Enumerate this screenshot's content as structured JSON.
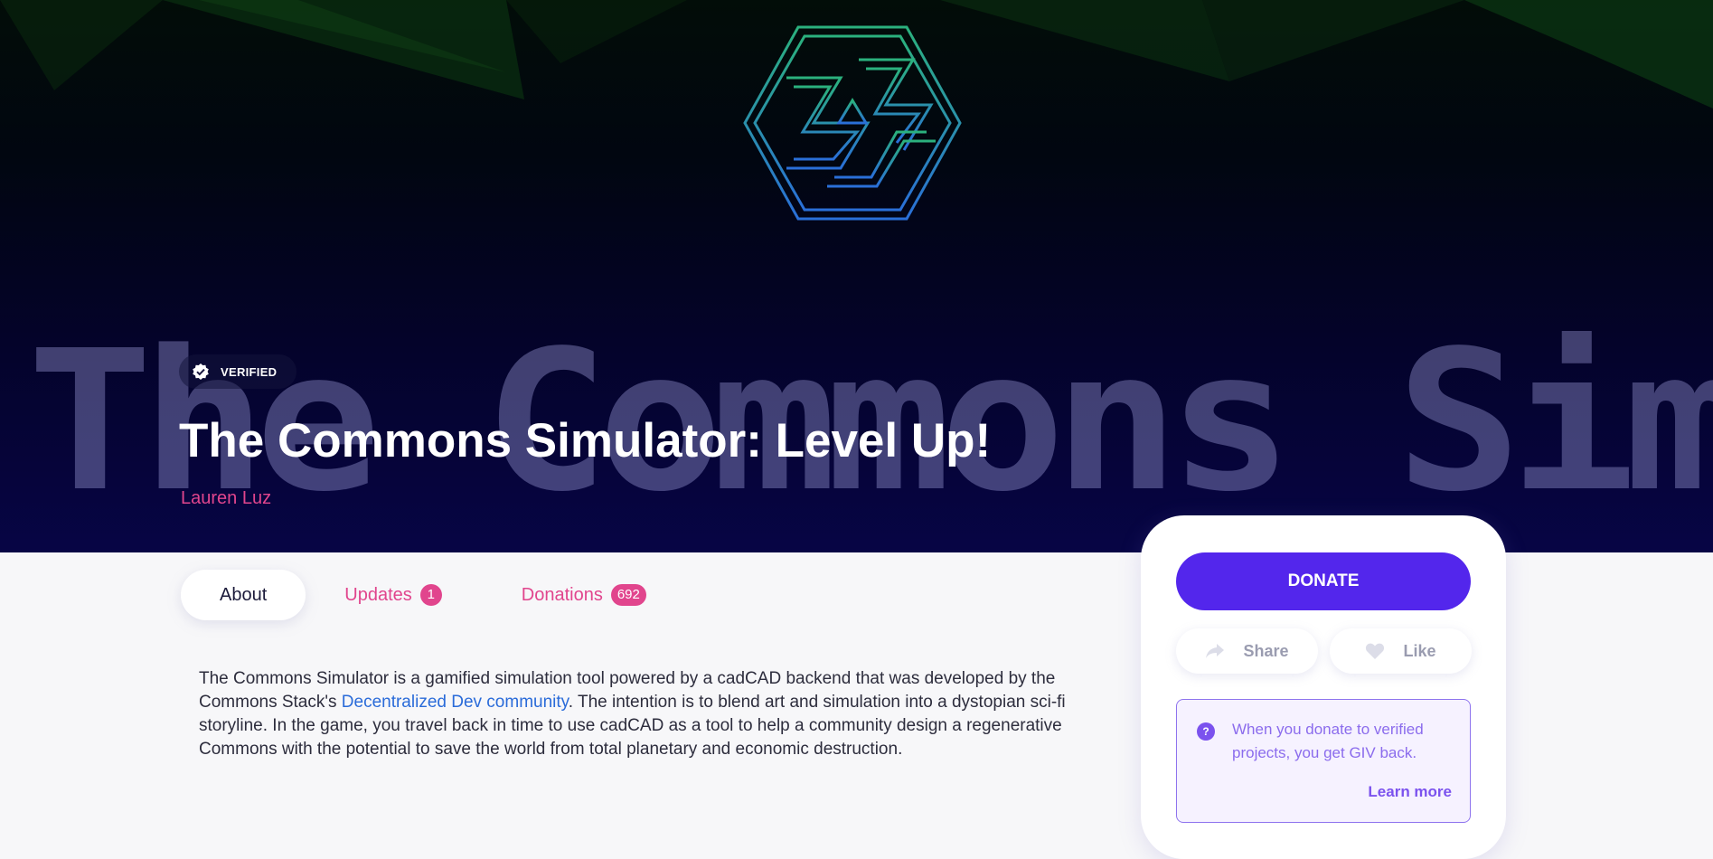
{
  "hero": {
    "watermark_text": "The Commons Simulator",
    "verified_label": "VERIFIED",
    "title": "The Commons Simulator: Level Up!",
    "author": "Lauren Luz"
  },
  "tabs": [
    {
      "label": "About",
      "active": true
    },
    {
      "label": "Updates",
      "count": "1"
    },
    {
      "label": "Donations",
      "count": "692"
    }
  ],
  "description": {
    "before_link": "The Commons Simulator is a gamified simulation tool powered by a cadCAD backend that was developed by the Commons Stack's ",
    "link_text": "Decentralized Dev community",
    "after_link": ". The intention is to blend art and simulation into a dystopian sci-fi storyline. In the game, you travel back in time to use cadCAD as a tool to help a community design a regenerative Commons with the potential to save the world from total planetary and economic destruction."
  },
  "donate_card": {
    "donate_label": "DONATE",
    "share_label": "Share",
    "like_label": "Like",
    "info_icon": "?",
    "info_text": "When you donate to verified projects, you get GIV back.",
    "learn_more": "Learn more"
  },
  "colors": {
    "accent_pink": "#e1458d",
    "donate_purple": "#5326ec",
    "link_blue": "#2a6bd9",
    "info_purple": "#8b6ced"
  },
  "icons": [
    "logo-mark",
    "verified-check-icon",
    "share-arrow-icon",
    "heart-icon",
    "question-icon"
  ]
}
